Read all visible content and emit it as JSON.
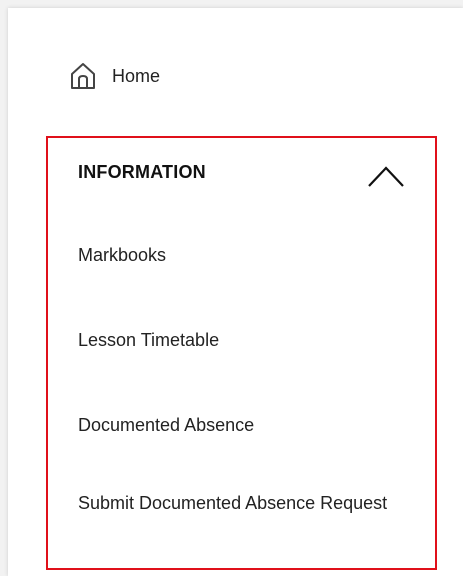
{
  "nav": {
    "home": {
      "label": "Home",
      "icon": "home-icon"
    },
    "section": {
      "title": "INFORMATION",
      "icon": "chevron-up-icon",
      "expanded": true,
      "highlight_color": "#e0101a",
      "items": [
        {
          "label": "Markbooks"
        },
        {
          "label": "Lesson Timetable"
        },
        {
          "label": "Documented Absence"
        },
        {
          "label": "Submit Documented Absence Request"
        }
      ]
    }
  }
}
